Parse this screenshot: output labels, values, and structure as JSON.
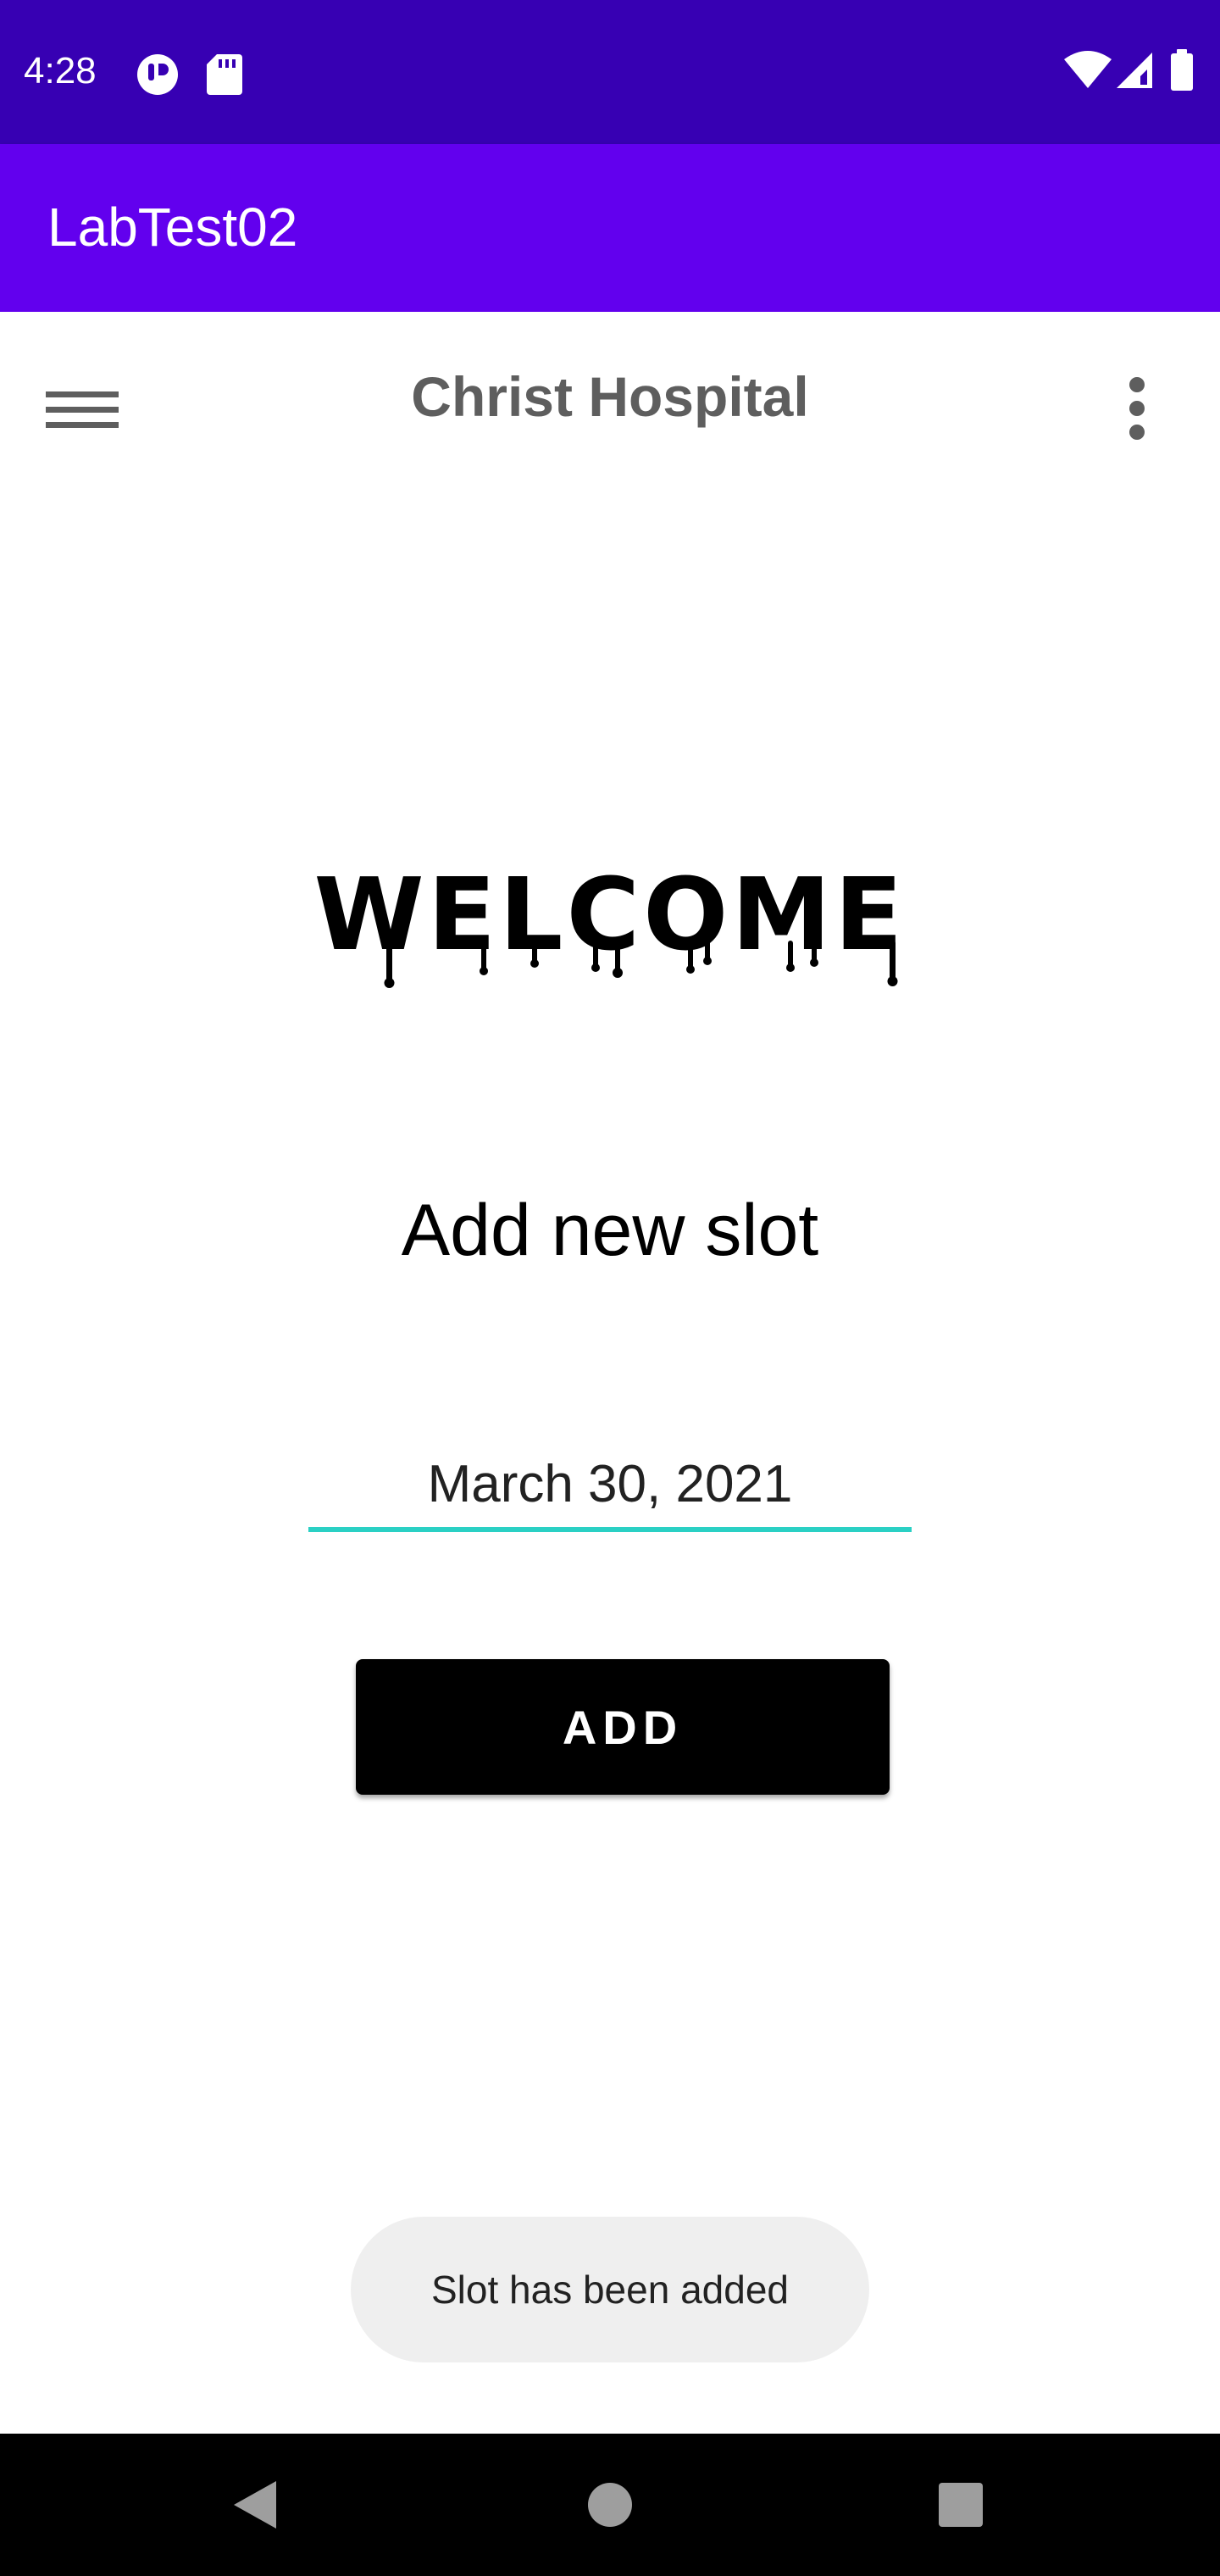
{
  "status_bar": {
    "time": "4:28",
    "left_icons": [
      "app-notification-icon",
      "sd-card-icon"
    ],
    "right_icons": [
      "wifi-icon",
      "cellular-signal-icon",
      "battery-icon"
    ]
  },
  "app_bar": {
    "title": "LabTest02",
    "color": "#6200ee",
    "status_color": "#3700b3"
  },
  "toolbar": {
    "title": "Christ Hospital",
    "menu_icon": "hamburger-menu-icon",
    "overflow_icon": "more-vert-icon"
  },
  "welcome": {
    "text": "WELCOME"
  },
  "form": {
    "heading": "Add new slot",
    "date_value": "March 30, 2021",
    "underline_color": "#2ad0c4",
    "add_button_label": "ADD"
  },
  "toast": {
    "message": "Slot has been added"
  },
  "nav_bar": {
    "buttons": [
      "back-icon",
      "home-icon",
      "recents-icon"
    ]
  }
}
